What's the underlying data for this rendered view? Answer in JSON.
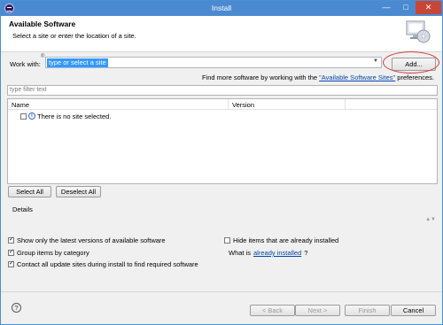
{
  "window": {
    "title": "Install",
    "minimize": "—",
    "maximize": "□",
    "close": "✕"
  },
  "header": {
    "title": "Available Software",
    "description": "Select a site or enter the location of a site."
  },
  "work_with": {
    "label": "Work with:",
    "marker": "®",
    "value": "type or select a site",
    "arrow": "▼",
    "add_button": "Add..."
  },
  "find_more": {
    "prefix": "Find more software by working with the ",
    "link": "\"Available Software Sites\"",
    "suffix": " preferences."
  },
  "filter": {
    "placeholder": "type filter text"
  },
  "tree": {
    "columns": [
      "Name",
      "Version"
    ],
    "rows": [
      {
        "label": "There is no site selected.",
        "checked": false,
        "icon": "info-icon"
      }
    ]
  },
  "buttons": {
    "select_all": "Select All",
    "deselect_all": "Deselect All"
  },
  "details": {
    "label": "Details",
    "scroll_glyph": "▲▼"
  },
  "options": {
    "show_latest": {
      "label": "Show only the latest versions of available software",
      "checked": true
    },
    "group_by_category": {
      "label": "Group items by category",
      "checked": true
    },
    "contact_all_sites": {
      "label": "Contact all update sites during install to find required software",
      "checked": true
    },
    "hide_installed": {
      "label": "Hide items that are already installed",
      "checked": false
    },
    "what_is": {
      "prefix": "What is ",
      "link": "already installed",
      "suffix": "?"
    }
  },
  "footer": {
    "help": "?",
    "back": "< Back",
    "next": "Next >",
    "finish": "Finish",
    "cancel": "Cancel"
  },
  "colors": {
    "titlebar": "#4b8ad0",
    "selection": "#3399ff",
    "link": "#0645ad",
    "highlight_ellipse": "#d23b3b",
    "close_button": "#c74636"
  }
}
